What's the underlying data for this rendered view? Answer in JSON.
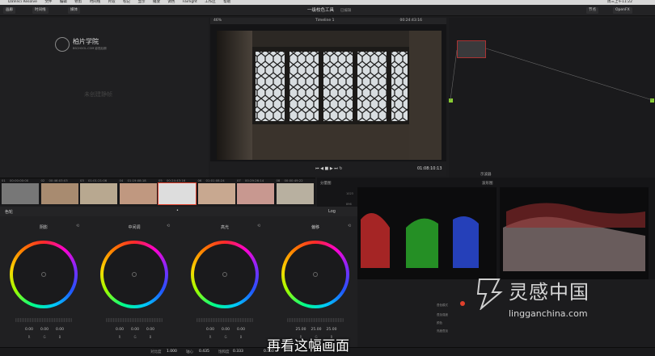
{
  "menubar": {
    "app": "DaVinci Resolve",
    "items": [
      "文件",
      "编辑",
      "修剪",
      "时间线",
      "片段",
      "标记",
      "显示",
      "播放",
      "调色",
      "Fairlight",
      "工作区",
      "帮助"
    ],
    "clock": "周三上午11:22"
  },
  "toolbar": {
    "gallery": "画廊",
    "timelines": "时间线",
    "lut": "LUT",
    "media": "媒体",
    "app_title": "一级校色工具",
    "app_sub": "已编辑",
    "nodes": "节点",
    "effects": "OpenFX",
    "lightbox": "光箱"
  },
  "gallery": {
    "logo_main": "柏片学院",
    "logo_sub": "BSCHOOL.COM 影视后期",
    "empty_text": "未创建静帧"
  },
  "viewer": {
    "zoom": "46%",
    "timeline": "Timeline 1",
    "tc_top": "00:24:43:16",
    "timecode": "01:08:10:13"
  },
  "clips": [
    {
      "n": "01",
      "tc": "00:00:00:00"
    },
    {
      "n": "02",
      "tc": "00:46:03:03"
    },
    {
      "n": "03",
      "tc": "01:01:21:06"
    },
    {
      "n": "04",
      "tc": "01:19:08:18"
    },
    {
      "n": "05",
      "tc": "00:24:43:16"
    },
    {
      "n": "06",
      "tc": "01:01:08:24"
    },
    {
      "n": "07",
      "tc": "00:29:26:14"
    },
    {
      "n": "08",
      "tc": "00:00:49:22"
    }
  ],
  "scopes": {
    "tab1": "分量图",
    "tab2": "波形图",
    "title": "示波器",
    "ticks": [
      "1023",
      "896",
      "768",
      "640",
      "512",
      "384",
      "256",
      "128"
    ]
  },
  "wheels": {
    "panel_title": "色轮",
    "mode": "Log",
    "items": [
      {
        "name": "阴影",
        "values": [
          "0.00",
          "0.00",
          "0.00"
        ]
      },
      {
        "name": "中间调",
        "values": [
          "0.00",
          "0.00",
          "0.00"
        ]
      },
      {
        "name": "高光",
        "values": [
          "0.00",
          "0.00",
          "0.00"
        ]
      },
      {
        "name": "偏移",
        "values": [
          "25.00",
          "25.00",
          "25.00"
        ]
      }
    ],
    "channels": [
      "R",
      "G",
      "B"
    ]
  },
  "bottom": {
    "contrast_label": "对比度",
    "contrast": "1.000",
    "pivot_label": "轴心",
    "pivot": "0.435",
    "sat_label": "饱和度",
    "sat": "0.333",
    "last": "0.550"
  },
  "right_panel": {
    "label1": "叠色模式",
    "label2": "叠加强度",
    "label3": "颜色",
    "label4": "亮度叠加"
  },
  "subtitle": "再看这幅画面",
  "watermark": {
    "main": "灵感中国",
    "sub": "lingganchina.com"
  },
  "colors": {
    "accent": "#e0402c",
    "wheel_bg": "#1a1a1c"
  }
}
